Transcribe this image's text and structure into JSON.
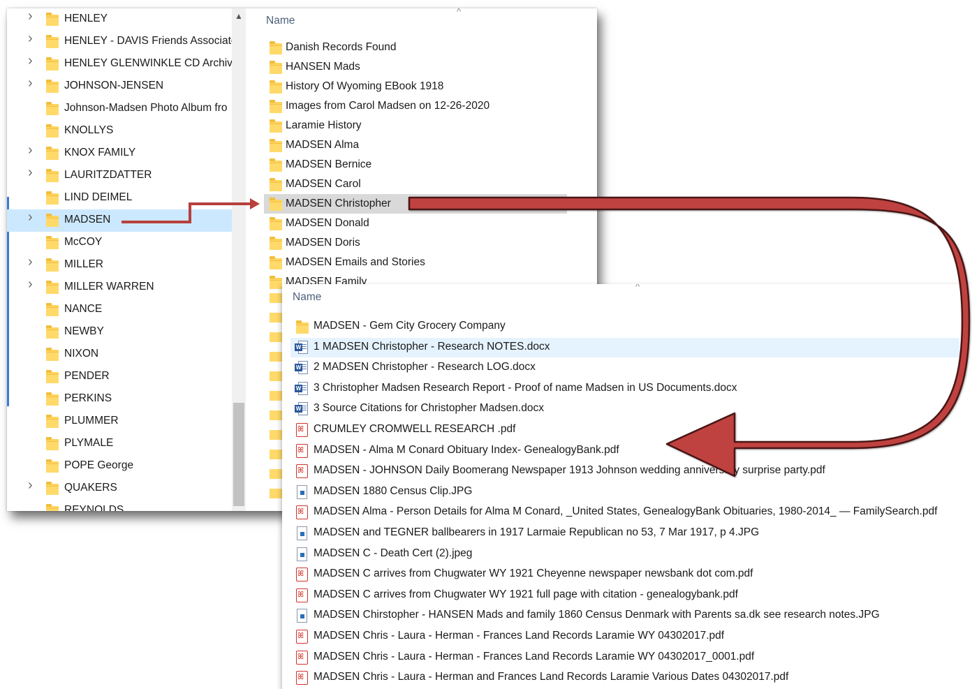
{
  "tree": {
    "items": [
      {
        "label": "HENLEY",
        "expandable": true,
        "selected": false
      },
      {
        "label": "HENLEY - DAVIS Friends Associate",
        "expandable": true,
        "selected": false
      },
      {
        "label": "HENLEY GLENWINKLE CD Archive",
        "expandable": true,
        "selected": false
      },
      {
        "label": "JOHNSON-JENSEN",
        "expandable": true,
        "selected": false
      },
      {
        "label": "Johnson-Madsen Photo Album fro",
        "expandable": false,
        "selected": false
      },
      {
        "label": "KNOLLYS",
        "expandable": false,
        "selected": false
      },
      {
        "label": "KNOX FAMILY",
        "expandable": true,
        "selected": false
      },
      {
        "label": "LAURITZDATTER",
        "expandable": true,
        "selected": false
      },
      {
        "label": "LIND DEIMEL",
        "expandable": false,
        "selected": false
      },
      {
        "label": "MADSEN",
        "expandable": true,
        "selected": true
      },
      {
        "label": "McCOY",
        "expandable": false,
        "selected": false
      },
      {
        "label": "MILLER",
        "expandable": true,
        "selected": false
      },
      {
        "label": "MILLER WARREN",
        "expandable": true,
        "selected": false
      },
      {
        "label": "NANCE",
        "expandable": false,
        "selected": false
      },
      {
        "label": "NEWBY",
        "expandable": false,
        "selected": false
      },
      {
        "label": "NIXON",
        "expandable": false,
        "selected": false
      },
      {
        "label": "PENDER",
        "expandable": false,
        "selected": false
      },
      {
        "label": "PERKINS",
        "expandable": false,
        "selected": false
      },
      {
        "label": "PLUMMER",
        "expandable": false,
        "selected": false
      },
      {
        "label": "PLYMALE",
        "expandable": false,
        "selected": false
      },
      {
        "label": "POPE George",
        "expandable": false,
        "selected": false
      },
      {
        "label": "QUAKERS",
        "expandable": true,
        "selected": false
      },
      {
        "label": "REYNOLDS",
        "expandable": false,
        "selected": false
      }
    ]
  },
  "list1": {
    "header": "Name",
    "items": [
      {
        "label": "Danish Records Found",
        "highlight": false
      },
      {
        "label": "HANSEN Mads",
        "highlight": false
      },
      {
        "label": "History Of Wyoming EBook 1918",
        "highlight": false
      },
      {
        "label": "Images from Carol Madsen on 12-26-2020",
        "highlight": false
      },
      {
        "label": "Laramie History",
        "highlight": false
      },
      {
        "label": "MADSEN Alma",
        "highlight": false
      },
      {
        "label": "MADSEN Bernice",
        "highlight": false
      },
      {
        "label": "MADSEN Carol",
        "highlight": false
      },
      {
        "label": "MADSEN Christopher",
        "highlight": true
      },
      {
        "label": "MADSEN Donald",
        "highlight": false
      },
      {
        "label": "MADSEN Doris",
        "highlight": false
      },
      {
        "label": "MADSEN Emails and Stories",
        "highlight": false
      },
      {
        "label": "MADSEN Family",
        "highlight": false
      }
    ]
  },
  "list2": {
    "header": "Name",
    "items": [
      {
        "label": "MADSEN - Gem City Grocery Company",
        "type": "folder-icon",
        "highlight": false
      },
      {
        "label": "1 MADSEN Christopher - Research NOTES.docx",
        "type": "word-doc-icon",
        "highlight": true
      },
      {
        "label": "2 MADSEN Christopher - Research LOG.docx",
        "type": "word-doc-icon",
        "highlight": false
      },
      {
        "label": "3 Christopher Madsen Research Report - Proof of name Madsen in US Documents.docx",
        "type": "word-doc-icon",
        "highlight": false
      },
      {
        "label": "3 Source Citations for Christopher Madsen.docx",
        "type": "word-doc-icon",
        "highlight": false
      },
      {
        "label": "CRUMLEY CROMWELL RESEARCH .pdf",
        "type": "pdf-icon",
        "highlight": false
      },
      {
        "label": "MADSEN - Alma M Conard Obituary Index- GenealogyBank.pdf",
        "type": "pdf-icon",
        "highlight": false
      },
      {
        "label": "MADSEN - JOHNSON Daily Boomerang Newspaper 1913 Johnson wedding anniversary surprise party.pdf",
        "type": "pdf-icon",
        "highlight": false
      },
      {
        "label": "MADSEN 1880 Census Clip.JPG",
        "type": "image-file-icon",
        "highlight": false
      },
      {
        "label": "MADSEN Alma - Person Details for Alma M Conard, _United States, GenealogyBank Obituaries, 1980-2014_ — FamilySearch.pdf",
        "type": "pdf-icon",
        "highlight": false
      },
      {
        "label": "MADSEN and TEGNER ballbearers in 1917 Larmaie Republican no 53, 7 Mar 1917, p 4.JPG",
        "type": "image-file-icon",
        "highlight": false
      },
      {
        "label": "MADSEN C - Death Cert (2).jpeg",
        "type": "image-file-icon",
        "highlight": false
      },
      {
        "label": "MADSEN C arrives from Chugwater WY 1921 Cheyenne newspaper newsbank dot com.pdf",
        "type": "pdf-icon",
        "highlight": false
      },
      {
        "label": "MADSEN C arrives from Chugwater WY 1921 full page with citation - genealogybank.pdf",
        "type": "pdf-icon",
        "highlight": false
      },
      {
        "label": "MADSEN Chirstopher - HANSEN Mads and family 1860 Census Denmark with Parents sa.dk see research notes.JPG",
        "type": "image-file-icon",
        "highlight": false
      },
      {
        "label": "MADSEN Chris - Laura - Herman - Frances Land Records Laramie WY 04302017.pdf",
        "type": "pdf-icon",
        "highlight": false
      },
      {
        "label": "MADSEN Chris - Laura - Herman - Frances Land Records Laramie WY 04302017_0001.pdf",
        "type": "pdf-icon",
        "highlight": false
      },
      {
        "label": "MADSEN Chris - Laura - Herman and Frances Land Records Laramie Various Dates 04302017.pdf",
        "type": "pdf-icon",
        "highlight": false
      }
    ]
  },
  "colors": {
    "selection": "#cce8ff",
    "row_highlight": "#d9d9d9",
    "file_highlight": "#e5f3ff",
    "arrow_red": "#c0423f",
    "folder": "#ffd45a"
  }
}
